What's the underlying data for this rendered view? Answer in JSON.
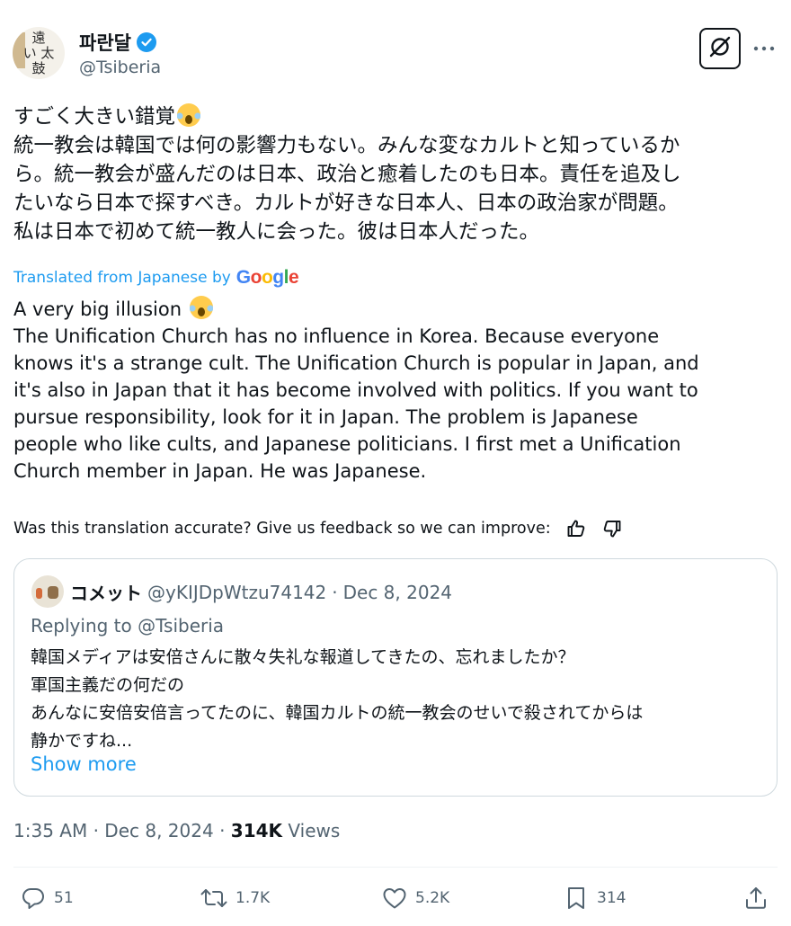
{
  "author": {
    "display_name": "파란달",
    "handle": "@Tsiberia",
    "avatar_glyphs": [
      "遠",
      "い",
      "太",
      "鼓"
    ]
  },
  "tweet": {
    "original_lines": [
      "すごく大きい錯覚",
      "統一教会は韓国では何の影響力もない。みんな変なカルトと知っているか",
      "ら。統一教会が盛んだのは日本、政治と癒着したのも日本。責任を追及し",
      "たいなら日本で探すべき。カルトが好きな日本人、日本の政治家が問題。",
      "私は日本で初めて統一教人に会った。彼は日本人だった。"
    ],
    "translated_from": "Translated from Japanese by",
    "google": [
      "G",
      "o",
      "o",
      "g",
      "l",
      "e"
    ],
    "translation_lines": [
      "A very big illusion",
      "The Unification Church has no influence in Korea. Because everyone",
      "knows it's a strange cult. The Unification Church is popular in Japan, and",
      "it's also in Japan that it has become involved with politics. If you want to",
      "pursue responsibility, look for it in Japan. The problem is Japanese",
      "people who like cults, and Japanese politicians. I first met a Unification",
      "Church member in Japan. He was Japanese."
    ],
    "feedback_prompt": "Was this translation accurate? Give us feedback so we can improve:"
  },
  "quote": {
    "name": "コメット",
    "handle": "@yKIJDpWtzu74142",
    "separator": "·",
    "date": "Dec 8, 2024",
    "replying_prefix": "Replying to",
    "replying_handle": "@Tsiberia",
    "text_lines": [
      "韓国メディアは安倍さんに散々失礼な報道してきたの、忘れましたか？",
      "軍国主義だの何だの",
      "あんなに安倍安倍言ってたのに、韓国カルトの統一教会のせいで殺されてからは",
      "静かですね..."
    ],
    "show_more": "Show more"
  },
  "meta": {
    "time": "1:35 AM",
    "sep1": "·",
    "date": "Dec 8, 2024",
    "sep2": "·",
    "views_count": "314K",
    "views_label": "Views"
  },
  "actions": {
    "replies": "51",
    "reposts": "1.7K",
    "likes": "5.2K",
    "bookmarks": "314"
  },
  "colors": {
    "accent": "#1d9bf0",
    "text": "#0f1419",
    "secondary": "#536471",
    "border": "#cfd9de"
  },
  "icons": [
    "verified-badge-icon",
    "grok-icon",
    "more-icon",
    "thumbs-up-icon",
    "thumbs-down-icon",
    "reply-icon",
    "repost-icon",
    "like-icon",
    "bookmark-icon",
    "share-icon"
  ]
}
